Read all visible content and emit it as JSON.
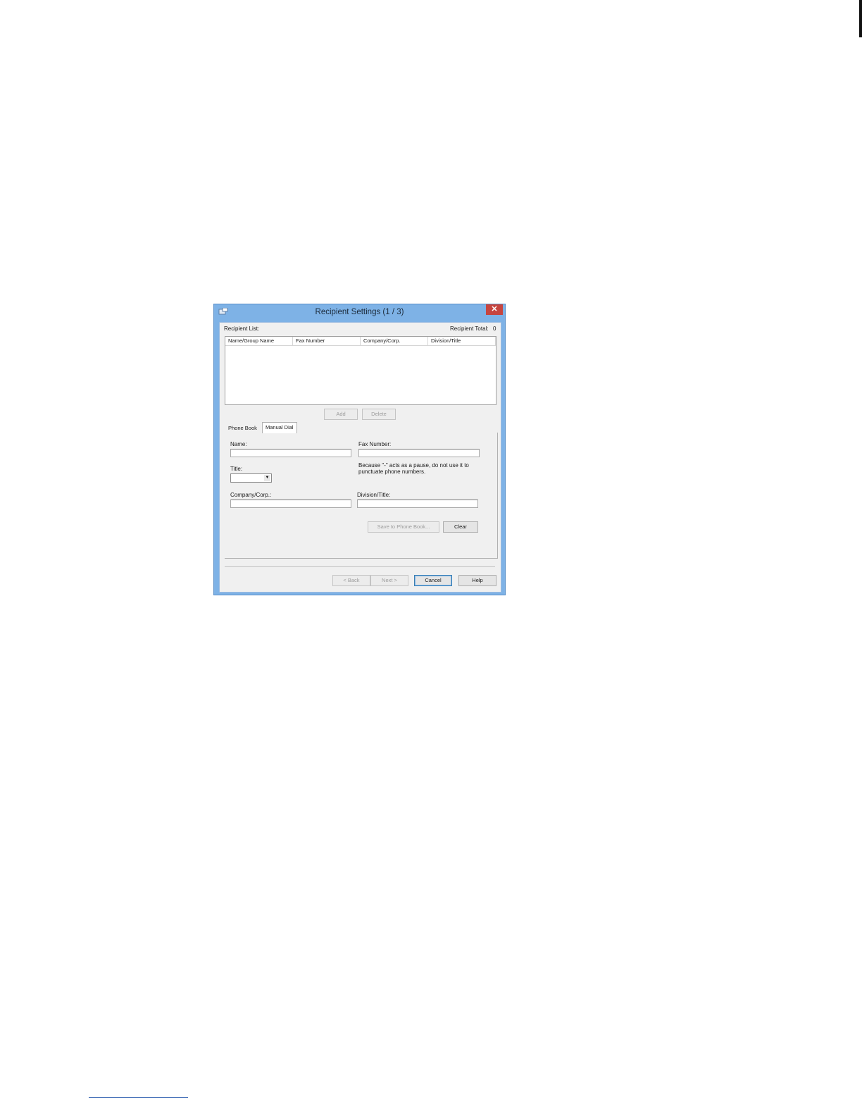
{
  "dialog": {
    "title": "Recipient Settings (1 / 3)",
    "close_label": "✕",
    "recipient_list_label": "Recipient List:",
    "recipient_total_label": "Recipient Total:",
    "recipient_total_value": "0",
    "columns": [
      "Name/Group Name",
      "Fax Number",
      "Company/Corp.",
      "Division/Title"
    ],
    "add_label": "Add",
    "delete_label": "Delete",
    "tabs": [
      "Phone Book",
      "Manual Dial"
    ],
    "active_tab": "Manual Dial",
    "form": {
      "name_label": "Name:",
      "name_value": "",
      "fax_label": "Fax Number:",
      "fax_value": "",
      "fax_hint_line1": "Because \"-\" acts as a pause, do not use it to",
      "fax_hint_line2": "punctuate phone numbers.",
      "title_label": "Title:",
      "title_value": "",
      "company_label": "Company/Corp.:",
      "company_value": "",
      "division_label": "Division/Title:",
      "division_value": "",
      "save_label": "Save to Phone Book...",
      "clear_label": "Clear"
    },
    "footer": {
      "back_label": "< Back",
      "next_label": "Next >",
      "cancel_label": "Cancel",
      "help_label": "Help"
    }
  },
  "colors": {
    "titlebar": "#7eb2e6",
    "close_button": "#c7453f",
    "client_bg": "#f0f0f0"
  },
  "icons": [
    "app-icon",
    "close-icon",
    "chevron-down-icon"
  ]
}
